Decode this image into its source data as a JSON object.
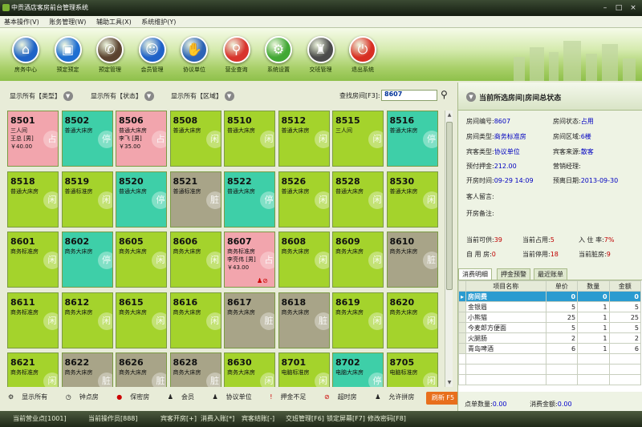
{
  "window": {
    "title": "中贡酒店客房前台管理系统"
  },
  "menu": [
    "基本操作(V)",
    "账务管理(W)",
    "辅助工具(X)",
    "系统维护(Y)"
  ],
  "toolbar": [
    {
      "label": "房务中心",
      "icon": "house-icon",
      "color": "#1e63c6",
      "glyph": "⌂"
    },
    {
      "label": "预定预定",
      "icon": "bag-icon",
      "color": "#1f6fd1",
      "glyph": "▣"
    },
    {
      "label": "预定管理",
      "icon": "phone-icon",
      "color": "#5b4330",
      "glyph": "✆"
    },
    {
      "label": "会员管理",
      "icon": "user-icon",
      "color": "#1f62c8",
      "glyph": "☺"
    },
    {
      "label": "协议单位",
      "icon": "handshake-icon",
      "color": "#2c64b6",
      "glyph": "✋"
    },
    {
      "label": "营业查询",
      "icon": "magnifier-icon",
      "color": "#d8342d",
      "glyph": "⚲"
    },
    {
      "label": "系统设置",
      "icon": "gear-icon",
      "color": "#42a835",
      "glyph": "⚙"
    },
    {
      "label": "交班管理",
      "icon": "shift-icon",
      "color": "#4b4b4b",
      "glyph": "♜"
    },
    {
      "label": "退出系统",
      "icon": "power-icon",
      "color": "#d82f23",
      "glyph": "⏻"
    }
  ],
  "filters": {
    "type": "显示所有【类型】",
    "status": "显示所有【状态】",
    "area": "显示所有【区域】",
    "search_label": "查找房间[F3]:",
    "search_value": "8607"
  },
  "colors": {
    "occupied": "#f2a5ad",
    "vacant": "#a4d32c",
    "dirty": "#a8a488",
    "reserved": "#3ecfa8"
  },
  "rooms": [
    {
      "num": "8501",
      "type": "三人间",
      "guest": "王总 [男]",
      "price": "￥40.00",
      "s": "occupied",
      "mark": "占"
    },
    {
      "num": "8502",
      "type": "普通大床房",
      "guest": "",
      "price": "",
      "s": "reserved",
      "mark": "停"
    },
    {
      "num": "8506",
      "type": "普通大床房",
      "guest": "李飞 [男]",
      "price": "￥35.00",
      "s": "occupied",
      "mark": "占"
    },
    {
      "num": "8508",
      "type": "普通大床房",
      "guest": "",
      "price": "",
      "s": "vacant",
      "mark": "闲"
    },
    {
      "num": "8510",
      "type": "普通大床房",
      "guest": "",
      "price": "",
      "s": "vacant",
      "mark": "闲"
    },
    {
      "num": "8512",
      "type": "普通大床房",
      "guest": "",
      "price": "",
      "s": "vacant",
      "mark": "闲"
    },
    {
      "num": "8515",
      "type": "三人间",
      "guest": "",
      "price": "",
      "s": "vacant",
      "mark": "闲"
    },
    {
      "num": "8516",
      "type": "普通大床房",
      "guest": "",
      "price": "",
      "s": "reserved",
      "mark": "停"
    },
    {
      "num": "8518",
      "type": "普通大床房",
      "guest": "",
      "price": "",
      "s": "vacant",
      "mark": "闲"
    },
    {
      "num": "8519",
      "type": "普通标准房",
      "guest": "",
      "price": "",
      "s": "vacant",
      "mark": "闲"
    },
    {
      "num": "8520",
      "type": "普通大床房",
      "guest": "",
      "price": "",
      "s": "reserved",
      "mark": "停"
    },
    {
      "num": "8521",
      "type": "普通标准房",
      "guest": "",
      "price": "",
      "s": "dirty",
      "mark": "脏"
    },
    {
      "num": "8522",
      "type": "普通大床房",
      "guest": "",
      "price": "",
      "s": "reserved",
      "mark": "停"
    },
    {
      "num": "8526",
      "type": "普通大床房",
      "guest": "",
      "price": "",
      "s": "vacant",
      "mark": "闲"
    },
    {
      "num": "8528",
      "type": "普通大床房",
      "guest": "",
      "price": "",
      "s": "vacant",
      "mark": "闲"
    },
    {
      "num": "8530",
      "type": "普通大床房",
      "guest": "",
      "price": "",
      "s": "vacant",
      "mark": "闲"
    },
    {
      "num": "8601",
      "type": "商务标准房",
      "guest": "",
      "price": "",
      "s": "vacant",
      "mark": "闲"
    },
    {
      "num": "8602",
      "type": "商务大床房",
      "guest": "",
      "price": "",
      "s": "reserved",
      "mark": "停"
    },
    {
      "num": "8605",
      "type": "商务大床房",
      "guest": "",
      "price": "",
      "s": "vacant",
      "mark": "闲"
    },
    {
      "num": "8606",
      "type": "商务大床房",
      "guest": "",
      "price": "",
      "s": "vacant",
      "mark": "闲"
    },
    {
      "num": "8607",
      "type": "商务标准房",
      "guest": "李亮伟 [男]",
      "price": "￥43.00",
      "s": "occupied",
      "mark": "占"
    },
    {
      "num": "8608",
      "type": "商务大床房",
      "guest": "",
      "price": "",
      "s": "vacant",
      "mark": "闲"
    },
    {
      "num": "8609",
      "type": "商务大床房",
      "guest": "",
      "price": "",
      "s": "vacant",
      "mark": "闲"
    },
    {
      "num": "8610",
      "type": "商务大床房",
      "guest": "",
      "price": "",
      "s": "dirty",
      "mark": "脏"
    },
    {
      "num": "8611",
      "type": "商务标准房",
      "guest": "",
      "price": "",
      "s": "vacant",
      "mark": "闲"
    },
    {
      "num": "8612",
      "type": "商务大床房",
      "guest": "",
      "price": "",
      "s": "vacant",
      "mark": "闲"
    },
    {
      "num": "8615",
      "type": "商务大床房",
      "guest": "",
      "price": "",
      "s": "vacant",
      "mark": "闲"
    },
    {
      "num": "8616",
      "type": "商务大床房",
      "guest": "",
      "price": "",
      "s": "vacant",
      "mark": "闲"
    },
    {
      "num": "8617",
      "type": "商务大床房",
      "guest": "",
      "price": "",
      "s": "dirty",
      "mark": "脏"
    },
    {
      "num": "8618",
      "type": "商务大床房",
      "guest": "",
      "price": "",
      "s": "dirty",
      "mark": "脏"
    },
    {
      "num": "8619",
      "type": "商务大床房",
      "guest": "",
      "price": "",
      "s": "vacant",
      "mark": "闲"
    },
    {
      "num": "8620",
      "type": "商务大床房",
      "guest": "",
      "price": "",
      "s": "vacant",
      "mark": "闲"
    },
    {
      "num": "8621",
      "type": "商务标准房",
      "guest": "",
      "price": "",
      "s": "vacant",
      "mark": "闲"
    },
    {
      "num": "8622",
      "type": "商务大床房",
      "guest": "",
      "price": "",
      "s": "dirty",
      "mark": "脏"
    },
    {
      "num": "8626",
      "type": "商务大床房",
      "guest": "",
      "price": "",
      "s": "dirty",
      "mark": "脏"
    },
    {
      "num": "8628",
      "type": "商务大床房",
      "guest": "",
      "price": "",
      "s": "dirty",
      "mark": "脏"
    },
    {
      "num": "8630",
      "type": "商务大床房",
      "guest": "",
      "price": "",
      "s": "vacant",
      "mark": "闲"
    },
    {
      "num": "8701",
      "type": "电脑标准房",
      "guest": "",
      "price": "",
      "s": "vacant",
      "mark": "闲"
    },
    {
      "num": "8702",
      "type": "电脑大床房",
      "guest": "",
      "price": "",
      "s": "reserved",
      "mark": "停"
    },
    {
      "num": "8705",
      "type": "电脑标准房",
      "guest": "",
      "price": "",
      "s": "vacant",
      "mark": "闲"
    }
  ],
  "legend": [
    "显示所有",
    "钟点房",
    "保密房",
    "会员",
    "协议单位",
    "押金不足",
    "超时房",
    "允许拼房"
  ],
  "refresh_label": "刷新 F5",
  "panel": {
    "title": "当前所选房间|房间总状态",
    "room_no_label": "房间编号:",
    "room_no": "8607",
    "room_status_label": "房间状态:",
    "room_status": "占用",
    "room_type_label": "房间类型:",
    "room_type": "商务标准房",
    "room_area_label": "房间区域:",
    "room_area": "6楼",
    "guest_type_label": "宾客类型:",
    "guest_type": "协议单位",
    "guest_source_label": "宾客来源:",
    "guest_source": "散客",
    "deposit_label": "预付押金:",
    "deposit": "212.00",
    "manager_label": "营销经理:",
    "open_time_label": "开房时间:",
    "open_time": "09-29 14:09",
    "leave_label": "预离日期:",
    "leave": "2013-09-30",
    "message_label": "客人留言:",
    "remark_label": "开房备注:",
    "avail_label": "当前可供:",
    "avail": "39",
    "occ_label": "当前占用:",
    "occ": "5",
    "rate_label": "入 住 率:",
    "rate": "7%",
    "self_label": "自 用 房:",
    "self": "0",
    "stop_label": "当前停用:",
    "stop": "18",
    "dirty_label": "当前脏房:",
    "dirty": "9"
  },
  "tabs": [
    "消费明细",
    "押金预警",
    "最近账单"
  ],
  "consume": {
    "headers": [
      "项目名称",
      "单价",
      "数量",
      "金额"
    ],
    "rows": [
      [
        "房间费",
        "0",
        "0",
        "0"
      ],
      [
        "金银眉",
        "5",
        "1",
        "5"
      ],
      [
        "小熊猫",
        "25",
        "1",
        "25"
      ],
      [
        "今麦郎方便面",
        "5",
        "1",
        "5"
      ],
      [
        "火腿肠",
        "2",
        "1",
        "2"
      ],
      [
        "青岛啤酒",
        "6",
        "1",
        "6"
      ]
    ]
  },
  "summary": {
    "count_label": "点单数量:",
    "count": "0.00",
    "amount_label": "消费金额:",
    "amount": "0.00"
  },
  "statusbar": [
    "当前营业点[1001]",
    "当前操作员[888]",
    "宾客开房[+]",
    "消费入账[*]",
    "宾客结账[-]",
    "交班管理[F6]",
    "锁定屏幕[F7]",
    "修改密码[F8]"
  ]
}
